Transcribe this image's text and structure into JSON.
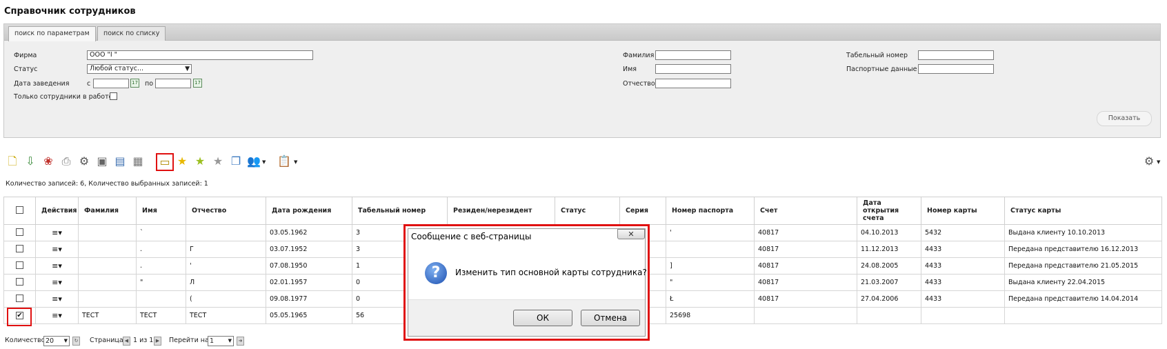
{
  "page_title": "Справочник сотрудников",
  "tabs": [
    {
      "label": "поиск по параметрам",
      "active": true
    },
    {
      "label": "поиск по списку",
      "active": false
    }
  ],
  "filters": {
    "firm_label": "Фирма",
    "firm_value": "ООО \"I                              \"",
    "status_label": "Статус",
    "status_value": "Любой статус...",
    "date_label": "Дата заведения",
    "date_from_label": "с",
    "date_to_label": "по",
    "only_working_label": "Только сотрудники в работе",
    "surname_label": "Фамилия",
    "name_label": "Имя",
    "patronymic_label": "Отчество",
    "tab_number_label": "Табельный номер",
    "passport_label": "Паспортные данные",
    "show_button": "Показать"
  },
  "toolbar": {
    "icons": [
      "new-document-icon",
      "download-icon",
      "ribbon-award-icon",
      "print-icon",
      "users-gear-icon",
      "id-card-icon",
      "id-card-edit-icon",
      "id-card-delete-icon",
      "card-swap-icon",
      "star-icon",
      "star-add-icon",
      "star-gray-icon",
      "window-refresh-icon",
      "users-group-icon",
      "clipboard-icon"
    ],
    "settings_icon": "gear-icon"
  },
  "records_info": "Количество записей: 6, Количество выбранных записей: 1",
  "table": {
    "headers": [
      "Действия",
      "Фамилия",
      "Имя",
      "Отчество",
      "Дата рождения",
      "Табельный номер",
      "Резиден/нерезидент",
      "Статус",
      "Серия",
      "Номер паспорта",
      "Счет",
      "Дата открытия счета",
      "Номер карты",
      "Статус карты"
    ],
    "rows": [
      {
        "checked": false,
        "surname": "",
        "name": "`",
        "patronymic": "",
        "birth": "03.05.1962",
        "tab": "3",
        "resident": "",
        "status": "",
        "series": "",
        "passport": "'",
        "account": "40817",
        "opened": "04.10.2013",
        "card": "5432",
        "card_status": "Выдана клиенту 10.10.2013"
      },
      {
        "checked": false,
        "surname": "",
        "name": ".",
        "patronymic": "Г",
        "birth": "03.07.1952",
        "tab": "3",
        "resident": "",
        "status": "",
        "series": "",
        "passport": "",
        "account": "40817",
        "opened": "11.12.2013",
        "card": "4433",
        "card_status": "Передана представителю 16.12.2013"
      },
      {
        "checked": false,
        "surname": "",
        "name": ".",
        "patronymic": "'",
        "birth": "07.08.1950",
        "tab": "1",
        "resident": "",
        "status": "",
        "series": "",
        "passport": "]",
        "account": "40817",
        "opened": "24.08.2005",
        "card": "4433",
        "card_status": "Передана представителю 21.05.2015"
      },
      {
        "checked": false,
        "surname": "",
        "name": "\"",
        "patronymic": "Л",
        "birth": "02.01.1957",
        "tab": "0",
        "resident": "",
        "status": "",
        "series": "",
        "passport": "\"",
        "account": "40817",
        "opened": "21.03.2007",
        "card": "4433",
        "card_status": "Выдана клиенту 22.04.2015"
      },
      {
        "checked": false,
        "surname": "",
        "name": "",
        "patronymic": "(",
        "birth": "09.08.1977",
        "tab": "0",
        "resident": "",
        "status": "",
        "series": "",
        "passport": "Ł",
        "account": "40817",
        "opened": "27.04.2006",
        "card": "4433",
        "card_status": "Передана представителю 14.04.2014"
      },
      {
        "checked": true,
        "surname": "ТЕСТ",
        "name": "ТЕСТ",
        "patronymic": "ТЕСТ",
        "birth": "05.05.1965",
        "tab": "56",
        "resident": "",
        "status": "",
        "series": "",
        "passport": "25698",
        "account": "",
        "opened": "",
        "card": "",
        "card_status": ""
      }
    ]
  },
  "pager": {
    "count_label": "Количество:",
    "count_value": "20",
    "page_label": "Страница:",
    "page_value": "1 из 1",
    "goto_label": "Перейти на:",
    "goto_value": "1"
  },
  "dialog": {
    "title": "Сообщение с веб-страницы",
    "close": "✕",
    "message": "Изменить тип основной карты сотрудника?",
    "ok": "ОК",
    "cancel": "Отмена",
    "icon": "question-icon"
  }
}
